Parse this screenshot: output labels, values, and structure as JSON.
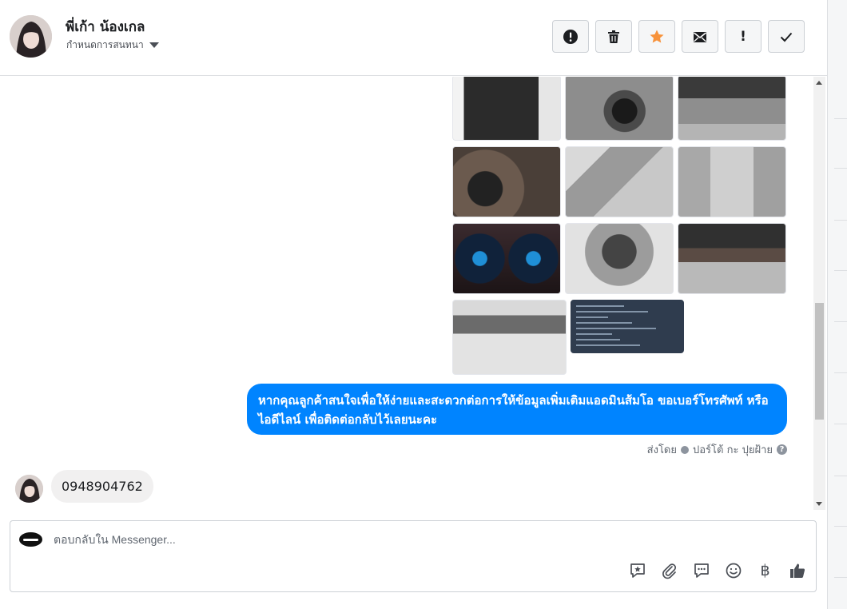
{
  "header": {
    "contact_name": "พี่เก้า น้องเกล",
    "assign_label": "กำหนดการสนทนา",
    "actions": [
      {
        "name": "spam-button",
        "icon": "alert-circle-icon"
      },
      {
        "name": "delete-button",
        "icon": "trash-icon"
      },
      {
        "name": "star-button",
        "icon": "star-icon"
      },
      {
        "name": "mark-unread-button",
        "icon": "envelope-icon"
      },
      {
        "name": "follow-up-button",
        "icon": "exclamation-icon",
        "glyph": "!"
      },
      {
        "name": "done-button",
        "icon": "checkmark-icon"
      }
    ],
    "star_color": "#f7923b"
  },
  "conversation": {
    "photos": [
      "door-panel",
      "steering-dashboard",
      "front-seats",
      "undercarriage",
      "driver-seat",
      "rear-seats",
      "gauge-cluster",
      "engine-bay",
      "chassis",
      "underside",
      "spec-sheet"
    ],
    "outgoing_message": "หากคุณลูกค้าสนใจเพื่อให้ง่ายและสะดวกต่อการให้ข้อมูลเพิ่มเติมแอดมินส้มโอ ขอเบอร์โทรศัพท์ หรือ ไอดีไลน์ เพื่อติดต่อกลับไว้เลยนะคะ",
    "sent_by_label": "ส่งโดย",
    "sent_by_name": "ปอร์โต้ กะ ปุยฝ้าย",
    "help_glyph": "?",
    "incoming_message": "0948904762",
    "bubble_color": "#0084ff"
  },
  "composer": {
    "placeholder": "ตอบกลับใน Messenger...",
    "value": "",
    "currency_glyph": "฿"
  }
}
